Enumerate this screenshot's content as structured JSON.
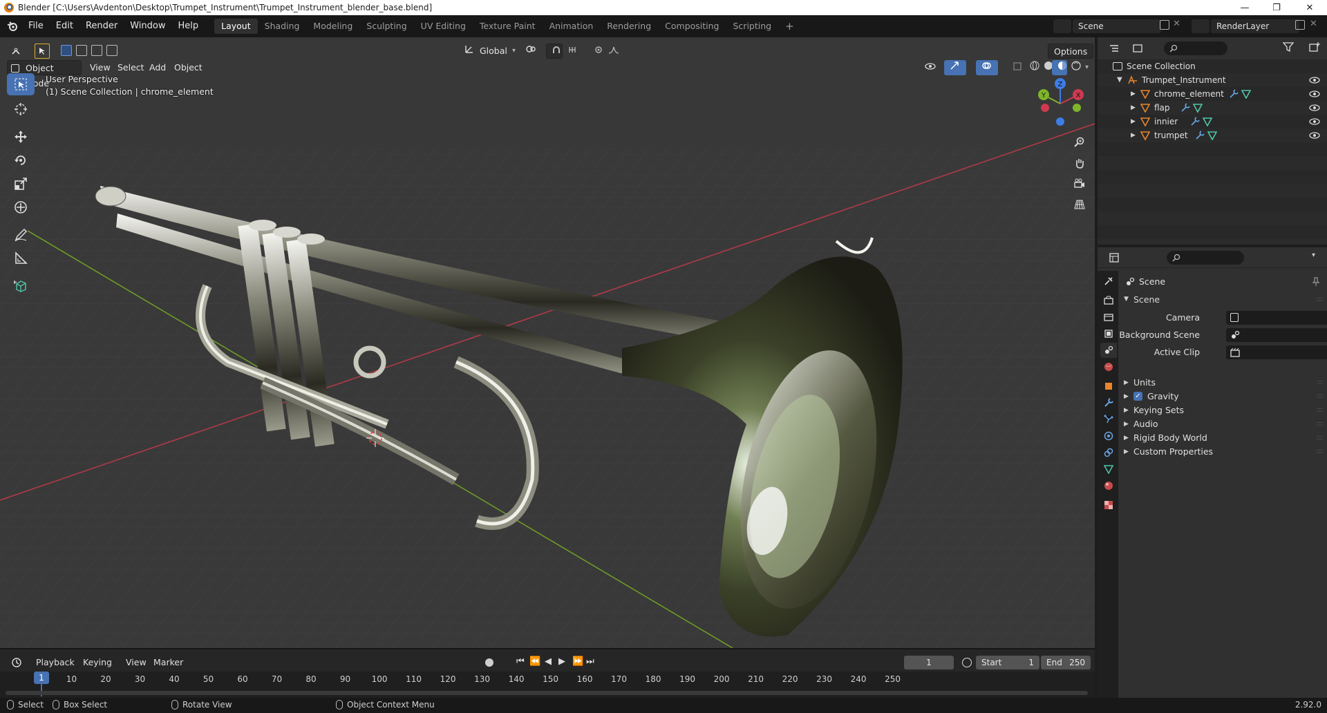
{
  "window": {
    "title": "Blender [C:\\Users\\Avdenton\\Desktop\\Trumpet_Instrument\\Trumpet_Instrument_blender_base.blend]",
    "minimize": "—",
    "maximize": "❐",
    "close": "✕"
  },
  "menu": [
    "File",
    "Edit",
    "Render",
    "Window",
    "Help"
  ],
  "workspaces": [
    "Layout",
    "Shading",
    "Modeling",
    "Sculpting",
    "UV Editing",
    "Texture Paint",
    "Animation",
    "Rendering",
    "Compositing",
    "Scripting"
  ],
  "active_workspace": "Layout",
  "add_workspace": "+",
  "scene_selector": "Scene",
  "view_layer": "RenderLayer",
  "viewport": {
    "mode": "Object Mode",
    "menus": [
      "View",
      "Select",
      "Add",
      "Object"
    ],
    "transform_orientation": "Global",
    "options_label": "Options",
    "perspective_text": "User Perspective",
    "context_text": "(1) Scene Collection | chrome_element",
    "gizmo_axes": {
      "x": "X",
      "y": "Y",
      "z": "Z"
    },
    "tools": [
      "select-box",
      "cursor",
      "move",
      "rotate",
      "scale",
      "transform",
      "annotate",
      "measure",
      "add-cube"
    ]
  },
  "outliner": {
    "root": "Scene Collection",
    "collection": "Trumpet_Instrument",
    "objects": [
      "chrome_element",
      "flap",
      "innier",
      "trumpet"
    ]
  },
  "properties": {
    "header": "Scene",
    "panel": "Scene",
    "fields": [
      {
        "label": "Camera",
        "value": ""
      },
      {
        "label": "Background Scene",
        "value": ""
      },
      {
        "label": "Active Clip",
        "value": ""
      }
    ],
    "sections": [
      "Units",
      "Gravity",
      "Keying Sets",
      "Audio",
      "Rigid Body World",
      "Custom Properties"
    ],
    "gravity_enabled": true
  },
  "timeline": {
    "menus": [
      "Playback",
      "Keying",
      "View",
      "Marker"
    ],
    "current_frame": "1",
    "start_label": "Start",
    "start_value": "1",
    "end_label": "End",
    "end_value": "250",
    "ruler": [
      "1",
      "10",
      "20",
      "30",
      "40",
      "50",
      "60",
      "70",
      "80",
      "90",
      "100",
      "110",
      "120",
      "130",
      "140",
      "150",
      "160",
      "170",
      "180",
      "190",
      "200",
      "210",
      "220",
      "230",
      "240",
      "250"
    ]
  },
  "statusbar": {
    "select": "Select",
    "box_select": "Box Select",
    "rotate_view": "Rotate View",
    "context_menu": "Object Context Menu",
    "version": "2.92.0"
  },
  "colors": {
    "accent": "#4772b3",
    "axis_x": "#cf3a4f",
    "axis_y": "#7fb52a",
    "axis_z": "#3d7de8",
    "object_orange": "#e8862b",
    "modifier_blue": "#6aa7e8",
    "mesh_green": "#4fc7a8"
  }
}
